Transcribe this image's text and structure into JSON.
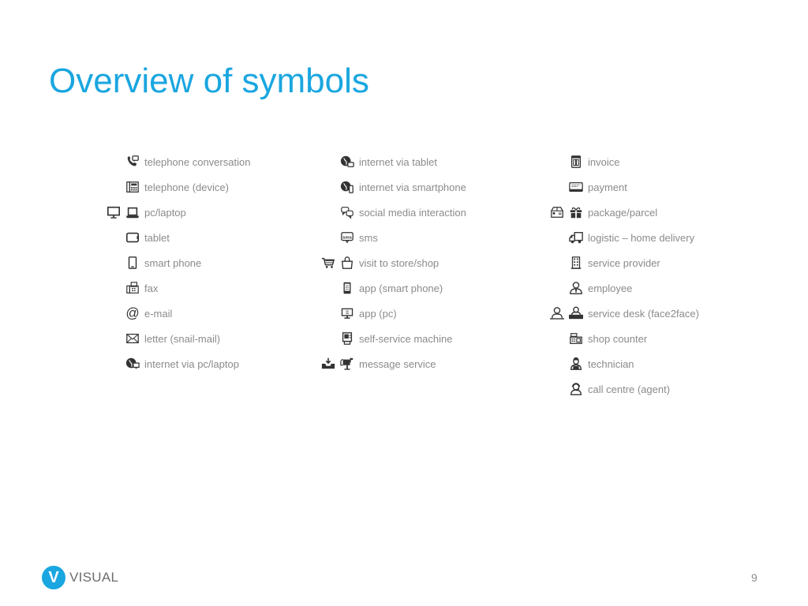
{
  "slide": {
    "title": "Overview of symbols",
    "page_number": "9",
    "colors": {
      "title": "#1aa6e0",
      "label": "#8b8b8b",
      "icon": "#333333",
      "brand": "#1aa6e0"
    }
  },
  "logo": {
    "mark": "V",
    "text": "VISUAL"
  },
  "columns": [
    {
      "items": [
        {
          "label": "telephone conversation",
          "icons": [
            "phone-chat-icon"
          ]
        },
        {
          "label": "telephone (device)",
          "icons": [
            "desk-phone-icon"
          ]
        },
        {
          "label": "pc/laptop",
          "icons": [
            "monitor-icon",
            "laptop-icon"
          ]
        },
        {
          "label": "tablet",
          "icons": [
            "tablet-icon"
          ]
        },
        {
          "label": "smart phone",
          "icons": [
            "smartphone-icon"
          ]
        },
        {
          "label": "fax",
          "icons": [
            "fax-icon"
          ]
        },
        {
          "label": "e-mail",
          "icons": [
            "at-sign-icon"
          ]
        },
        {
          "label": "letter (snail-mail)",
          "icons": [
            "envelope-icon"
          ]
        },
        {
          "label": "internet via pc/laptop",
          "icons": [
            "globe-pc-icon"
          ]
        }
      ]
    },
    {
      "items": [
        {
          "label": "internet via tablet",
          "icons": [
            "globe-tablet-icon"
          ]
        },
        {
          "label": "internet via smartphone",
          "icons": [
            "globe-smartphone-icon"
          ]
        },
        {
          "label": "social media interaction",
          "icons": [
            "chat-bubbles-icon"
          ]
        },
        {
          "label": "sms",
          "icons": [
            "sms-icon"
          ]
        },
        {
          "label": "visit to store/shop",
          "icons": [
            "shopping-cart-icon",
            "shopping-bag-icon"
          ]
        },
        {
          "label": "app (smart phone)",
          "icons": [
            "phone-app-icon"
          ]
        },
        {
          "label": "app (pc)",
          "icons": [
            "pc-app-icon"
          ]
        },
        {
          "label": "self-service machine",
          "icons": [
            "kiosk-icon"
          ]
        },
        {
          "label": "message service",
          "icons": [
            "inbox-download-icon",
            "mailbox-icon"
          ]
        }
      ]
    },
    {
      "items": [
        {
          "label": "invoice",
          "icons": [
            "invoice-icon"
          ]
        },
        {
          "label": "payment",
          "icons": [
            "card-icon"
          ]
        },
        {
          "label": "package/parcel",
          "icons": [
            "box-icon",
            "gift-icon"
          ]
        },
        {
          "label": "logistic – home delivery",
          "icons": [
            "truck-icon"
          ]
        },
        {
          "label": "service provider",
          "icons": [
            "building-icon"
          ]
        },
        {
          "label": "employee",
          "icons": [
            "person-tie-icon"
          ]
        },
        {
          "label": "service desk (face2face)",
          "icons": [
            "person-icon",
            "person-desk-icon"
          ]
        },
        {
          "label": "shop counter",
          "icons": [
            "cash-register-icon"
          ]
        },
        {
          "label": "technician",
          "icons": [
            "technician-icon"
          ]
        },
        {
          "label": "call centre (agent)",
          "icons": [
            "headset-agent-icon"
          ]
        }
      ]
    }
  ]
}
